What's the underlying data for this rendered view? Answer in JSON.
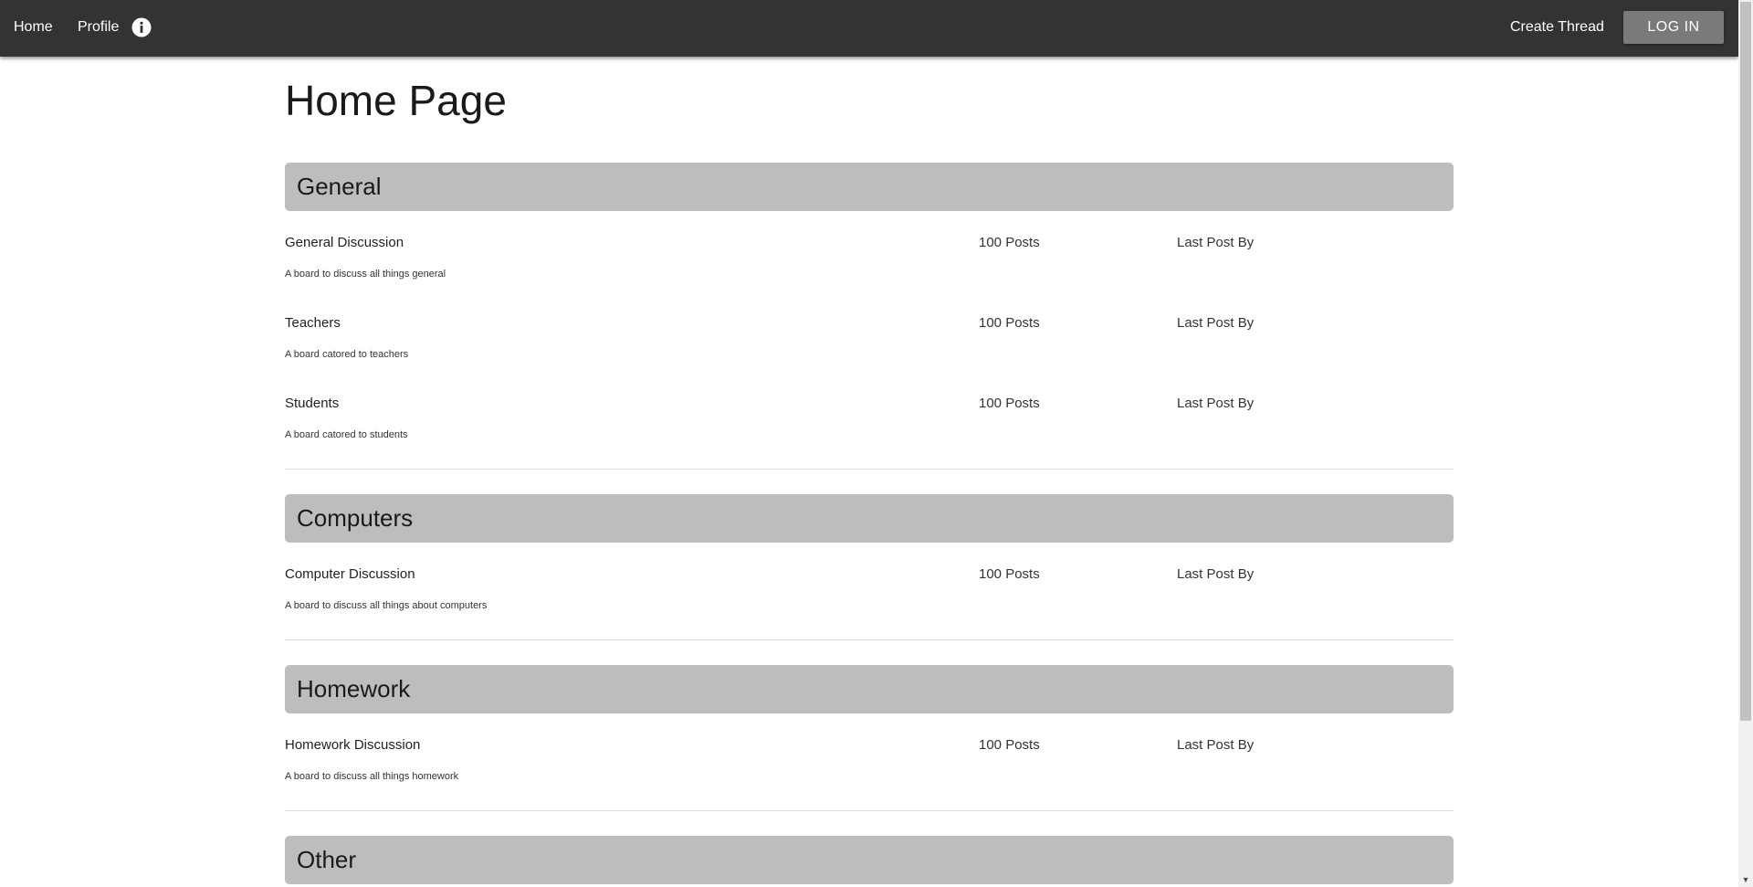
{
  "nav": {
    "home_label": "Home",
    "profile_label": "Profile",
    "create_thread_label": "Create Thread",
    "login_label": "LOG IN"
  },
  "page": {
    "title": "Home Page"
  },
  "categories": [
    {
      "name": "General",
      "boards": [
        {
          "name": "General Discussion",
          "posts": "100 Posts",
          "last_post": "Last Post By",
          "description": "A board to discuss all things general"
        },
        {
          "name": "Teachers",
          "posts": "100 Posts",
          "last_post": "Last Post By",
          "description": "A board catored to teachers"
        },
        {
          "name": "Students",
          "posts": "100 Posts",
          "last_post": "Last Post By",
          "description": "A board catored to students"
        }
      ]
    },
    {
      "name": "Computers",
      "boards": [
        {
          "name": "Computer Discussion",
          "posts": "100 Posts",
          "last_post": "Last Post By",
          "description": "A board to discuss all things about computers"
        }
      ]
    },
    {
      "name": "Homework",
      "boards": [
        {
          "name": "Homework Discussion",
          "posts": "100 Posts",
          "last_post": "Last Post By",
          "description": "A board to discuss all things homework"
        }
      ]
    },
    {
      "name": "Other",
      "boards": []
    }
  ],
  "icons": {
    "info": "info-icon"
  },
  "colors": {
    "navbar": "#333333",
    "category_header": "#bdbdbd",
    "login_button": "#7a7a7a"
  }
}
